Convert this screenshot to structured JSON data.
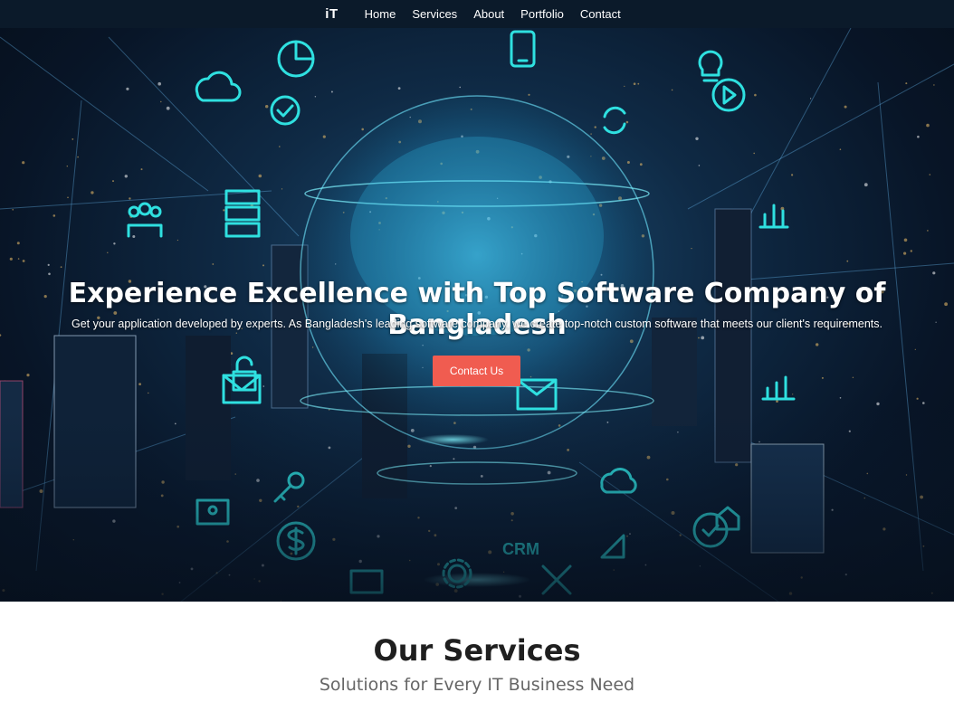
{
  "nav": {
    "brand": "iT",
    "links": [
      "Home",
      "Services",
      "About",
      "Portfolio",
      "Contact"
    ]
  },
  "hero": {
    "title": "Experience Excellence with Top Software Company of Bangladesh",
    "subtitle": "Get your application developed by experts. As Bangladesh's leading software company, we create top-notch custom software that meets our client's requirements.",
    "cta_label": "Contact Us",
    "cta_color": "#f05c50",
    "accent_color": "#2fe0e0",
    "background_image": "night city skyline with glowing digital globe and tech icons",
    "icons": [
      "pie-chart-icon",
      "cloud-icon",
      "check-circle-icon",
      "mobile-icon",
      "lightbulb-icon",
      "play-icon",
      "users-icon",
      "server-icon",
      "lock-icon",
      "mail-icon",
      "key-icon",
      "dollar-icon",
      "gear-icon",
      "crm-icon",
      "tools-icon",
      "id-card-icon",
      "monitor-icon",
      "bar-chart-icon",
      "home-icon",
      "cloud-upload-icon"
    ]
  },
  "services": {
    "title": "Our Services",
    "subtitle": "Solutions for Every IT Business Need"
  }
}
